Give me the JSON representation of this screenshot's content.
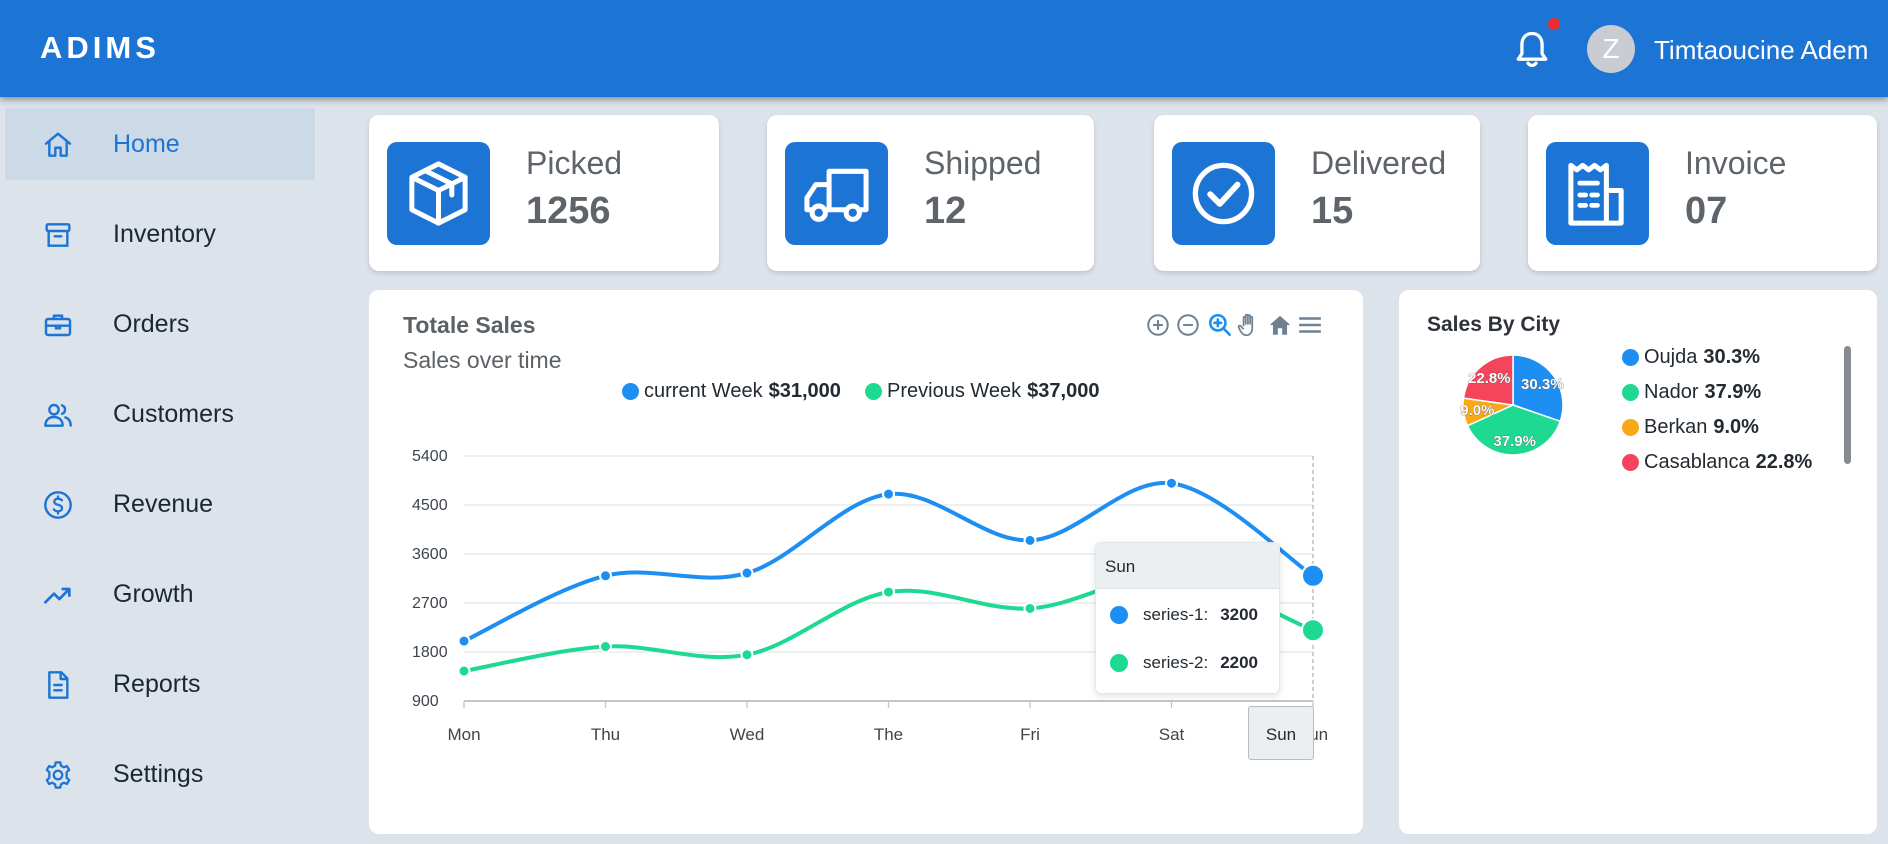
{
  "header": {
    "brand": "ADIMS",
    "avatar_initial": "Z",
    "user_name": "Timtaoucine Adem"
  },
  "sidebar": {
    "items": [
      {
        "label": "Home",
        "icon": "home-icon",
        "active": true
      },
      {
        "label": "Inventory",
        "icon": "archive-icon"
      },
      {
        "label": "Orders",
        "icon": "briefcase-icon"
      },
      {
        "label": "Customers",
        "icon": "users-icon"
      },
      {
        "label": "Revenue",
        "icon": "dollar-circle-icon"
      },
      {
        "label": "Growth",
        "icon": "trending-up-icon"
      },
      {
        "label": "Reports",
        "icon": "document-icon"
      },
      {
        "label": "Settings",
        "icon": "gear-icon"
      }
    ]
  },
  "stats": [
    {
      "label": "Picked",
      "value": "1256",
      "icon": "package-icon"
    },
    {
      "label": "Shipped",
      "value": "12",
      "icon": "truck-icon"
    },
    {
      "label": "Delivered",
      "value": "15",
      "icon": "check-circle-icon"
    },
    {
      "label": "Invoice",
      "value": "07",
      "icon": "receipt-icon"
    }
  ],
  "sales_chart": {
    "title": "Totale Sales",
    "subtitle": "Sales over time",
    "legend": [
      {
        "name": "current Week",
        "total": "$31,000",
        "color": "#1e8ff2"
      },
      {
        "name": "Previous Week",
        "total": "$37,000",
        "color": "#1ed992"
      }
    ],
    "toolbar": [
      "zoom-in-icon",
      "zoom-out-icon",
      "magnify-icon",
      "pan-hand-icon",
      "reset-home-icon",
      "menu-icon"
    ],
    "tooltip": {
      "title": "Sun",
      "rows": [
        {
          "series": "series-1:",
          "value": "3200"
        },
        {
          "series": "series-2:",
          "value": "2200"
        }
      ]
    },
    "x_tooltip": "Sun"
  },
  "city_chart": {
    "title": "Sales By City",
    "legend": [
      {
        "name": "Oujda",
        "pct": "30.3%",
        "color": "#1e8ff2"
      },
      {
        "name": "Nador",
        "pct": "37.9%",
        "color": "#1ed992"
      },
      {
        "name": "Berkan",
        "pct": "9.0%",
        "color": "#f9a918"
      },
      {
        "name": "Casablanca",
        "pct": "22.8%",
        "color": "#f5455c"
      }
    ]
  },
  "chart_data": [
    {
      "type": "line",
      "title": "Totale Sales",
      "subtitle": "Sales over time",
      "categories": [
        "Mon",
        "Thu",
        "Wed",
        "The",
        "Fri",
        "Sat",
        "Sun"
      ],
      "series": [
        {
          "name": "series-1",
          "color": "#1e8ff2",
          "values": [
            2000,
            3200,
            3250,
            4700,
            3850,
            4900,
            3200
          ]
        },
        {
          "name": "series-2",
          "color": "#1ed992",
          "values": [
            1450,
            1900,
            1750,
            2900,
            2600,
            3200,
            2200
          ]
        }
      ],
      "y_ticks": [
        900,
        1800,
        2700,
        3600,
        4500,
        5400
      ],
      "ylim": [
        900,
        5400
      ],
      "curve": "smooth"
    },
    {
      "type": "pie",
      "title": "Sales By City",
      "labels": [
        "Oujda",
        "Nador",
        "Berkan",
        "Casablanca"
      ],
      "values": [
        30.3,
        37.9,
        9.0,
        22.8
      ],
      "colors": [
        "#1e8ff2",
        "#1ed992",
        "#f9a918",
        "#f5455c"
      ],
      "data_labels": [
        "30.3%",
        "37.9%",
        "9.0%",
        "22.8%"
      ]
    }
  ]
}
